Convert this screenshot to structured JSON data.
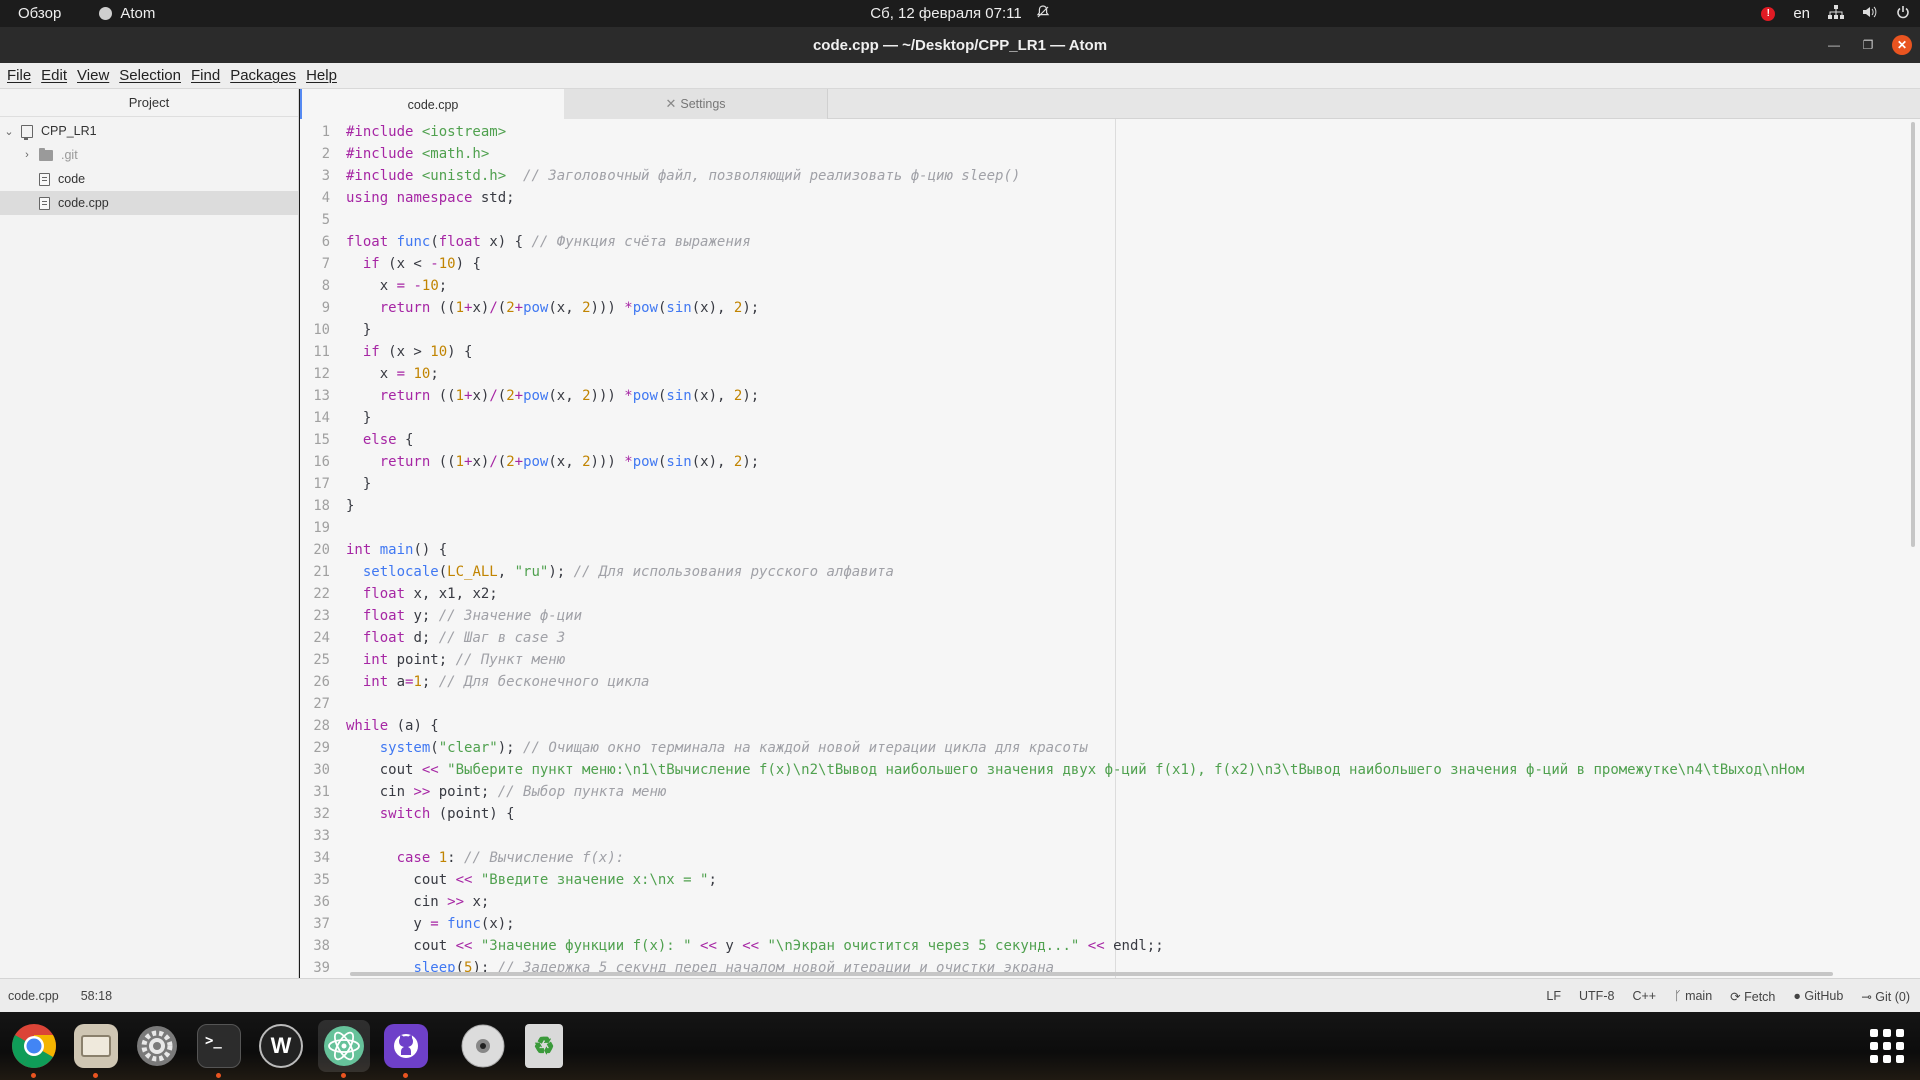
{
  "topbar": {
    "activities": "Обзор",
    "app_name": "Atom",
    "datetime": "Сб, 12 февраля  07:11",
    "notif_count": "!",
    "lang": "en"
  },
  "window": {
    "title": "code.cpp — ~/Desktop/CPP_LR1 — Atom"
  },
  "menu": [
    "File",
    "Edit",
    "View",
    "Selection",
    "Find",
    "Packages",
    "Help"
  ],
  "tree": {
    "header": "Project",
    "root": "CPP_LR1",
    "items": [
      ".git",
      "code",
      "code.cpp"
    ]
  },
  "tabs": [
    {
      "label": "code.cpp"
    },
    {
      "label": "Settings"
    }
  ],
  "editor": {
    "line_numbers": [
      "1",
      "2",
      "3",
      "4",
      "5",
      "6",
      "7",
      "8",
      "9",
      "10",
      "11",
      "12",
      "13",
      "14",
      "15",
      "16",
      "17",
      "18",
      "19",
      "20",
      "21",
      "22",
      "23",
      "24",
      "25",
      "26",
      "27",
      "28",
      "29",
      "30",
      "31",
      "32",
      "33",
      "34",
      "35",
      "36",
      "37",
      "38",
      "39"
    ],
    "lines": [
      [
        [
          "pp",
          "#include "
        ],
        [
          "str",
          "<iostream>"
        ]
      ],
      [
        [
          "pp",
          "#include "
        ],
        [
          "str",
          "<math.h>"
        ]
      ],
      [
        [
          "pp",
          "#include "
        ],
        [
          "str",
          "<unistd.h>"
        ],
        [
          "",
          "  "
        ],
        [
          "cm",
          "// Заголовочный файл, позволяющий реализовать ф-цию sleep()"
        ]
      ],
      [
        [
          "kw",
          "using"
        ],
        [
          "",
          " "
        ],
        [
          "kw",
          "namespace"
        ],
        [
          "",
          " std;"
        ]
      ],
      [],
      [
        [
          "ty",
          "float"
        ],
        [
          "",
          " "
        ],
        [
          "fn",
          "func"
        ],
        [
          "",
          "("
        ],
        [
          "ty",
          "float"
        ],
        [
          "",
          " x) { "
        ],
        [
          "cm",
          "// Функция счёта выражения"
        ]
      ],
      [
        [
          "",
          "  "
        ],
        [
          "kw",
          "if"
        ],
        [
          "",
          " (x < "
        ],
        [
          "op",
          "-"
        ],
        [
          "num",
          "10"
        ],
        [
          "",
          ") {"
        ]
      ],
      [
        [
          "",
          "    x "
        ],
        [
          "op",
          "="
        ],
        [
          "",
          " "
        ],
        [
          "op",
          "-"
        ],
        [
          "num",
          "10"
        ],
        [
          "",
          ";"
        ]
      ],
      [
        [
          "",
          "    "
        ],
        [
          "kw",
          "return"
        ],
        [
          "",
          " (("
        ],
        [
          "num",
          "1"
        ],
        [
          "op",
          "+"
        ],
        [
          "",
          "x)"
        ],
        [
          "op",
          "/"
        ],
        [
          "",
          "("
        ],
        [
          "num",
          "2"
        ],
        [
          "op",
          "+"
        ],
        [
          "fn",
          "pow"
        ],
        [
          "",
          "(x, "
        ],
        [
          "num",
          "2"
        ],
        [
          "",
          "))) "
        ],
        [
          "op",
          "*"
        ],
        [
          "fn",
          "pow"
        ],
        [
          "",
          "("
        ],
        [
          "fn",
          "sin"
        ],
        [
          "",
          "(x), "
        ],
        [
          "num",
          "2"
        ],
        [
          "",
          ");"
        ]
      ],
      [
        [
          "",
          "  }"
        ]
      ],
      [
        [
          "",
          "  "
        ],
        [
          "kw",
          "if"
        ],
        [
          "",
          " (x > "
        ],
        [
          "num",
          "10"
        ],
        [
          "",
          ") {"
        ]
      ],
      [
        [
          "",
          "    x "
        ],
        [
          "op",
          "="
        ],
        [
          "",
          " "
        ],
        [
          "num",
          "10"
        ],
        [
          "",
          ";"
        ]
      ],
      [
        [
          "",
          "    "
        ],
        [
          "kw",
          "return"
        ],
        [
          "",
          " (("
        ],
        [
          "num",
          "1"
        ],
        [
          "op",
          "+"
        ],
        [
          "",
          "x)"
        ],
        [
          "op",
          "/"
        ],
        [
          "",
          "("
        ],
        [
          "num",
          "2"
        ],
        [
          "op",
          "+"
        ],
        [
          "fn",
          "pow"
        ],
        [
          "",
          "(x, "
        ],
        [
          "num",
          "2"
        ],
        [
          "",
          "))) "
        ],
        [
          "op",
          "*"
        ],
        [
          "fn",
          "pow"
        ],
        [
          "",
          "("
        ],
        [
          "fn",
          "sin"
        ],
        [
          "",
          "(x), "
        ],
        [
          "num",
          "2"
        ],
        [
          "",
          ");"
        ]
      ],
      [
        [
          "",
          "  }"
        ]
      ],
      [
        [
          "",
          "  "
        ],
        [
          "kw",
          "else"
        ],
        [
          "",
          " {"
        ]
      ],
      [
        [
          "",
          "    "
        ],
        [
          "kw",
          "return"
        ],
        [
          "",
          " (("
        ],
        [
          "num",
          "1"
        ],
        [
          "op",
          "+"
        ],
        [
          "",
          "x)"
        ],
        [
          "op",
          "/"
        ],
        [
          "",
          "("
        ],
        [
          "num",
          "2"
        ],
        [
          "op",
          "+"
        ],
        [
          "fn",
          "pow"
        ],
        [
          "",
          "(x, "
        ],
        [
          "num",
          "2"
        ],
        [
          "",
          "))) "
        ],
        [
          "op",
          "*"
        ],
        [
          "fn",
          "pow"
        ],
        [
          "",
          "("
        ],
        [
          "fn",
          "sin"
        ],
        [
          "",
          "(x), "
        ],
        [
          "num",
          "2"
        ],
        [
          "",
          ");"
        ]
      ],
      [
        [
          "",
          "  }"
        ]
      ],
      [
        [
          "",
          "}"
        ]
      ],
      [],
      [
        [
          "ty",
          "int"
        ],
        [
          "",
          " "
        ],
        [
          "fn",
          "main"
        ],
        [
          "",
          "() {"
        ]
      ],
      [
        [
          "",
          "  "
        ],
        [
          "fn",
          "setlocale"
        ],
        [
          "",
          "("
        ],
        [
          "cn",
          "LC_ALL"
        ],
        [
          "",
          ", "
        ],
        [
          "str",
          "\"ru\""
        ],
        [
          "",
          "); "
        ],
        [
          "cm",
          "// Для использования русского алфавита"
        ]
      ],
      [
        [
          "",
          "  "
        ],
        [
          "ty",
          "float"
        ],
        [
          "",
          " x, x1, x2;"
        ]
      ],
      [
        [
          "",
          "  "
        ],
        [
          "ty",
          "float"
        ],
        [
          "",
          " y; "
        ],
        [
          "cm",
          "// Значение ф-ции"
        ]
      ],
      [
        [
          "",
          "  "
        ],
        [
          "ty",
          "float"
        ],
        [
          "",
          " d; "
        ],
        [
          "cm",
          "// Шаг в case 3"
        ]
      ],
      [
        [
          "",
          "  "
        ],
        [
          "ty",
          "int"
        ],
        [
          "",
          " point; "
        ],
        [
          "cm",
          "// Пункт меню"
        ]
      ],
      [
        [
          "",
          "  "
        ],
        [
          "ty",
          "int"
        ],
        [
          "",
          " a"
        ],
        [
          "op",
          "="
        ],
        [
          "num",
          "1"
        ],
        [
          "",
          "; "
        ],
        [
          "cm",
          "// Для бесконечного цикла"
        ]
      ],
      [],
      [
        [
          "kw",
          "while"
        ],
        [
          "",
          " (a) {"
        ]
      ],
      [
        [
          "",
          "    "
        ],
        [
          "fn",
          "system"
        ],
        [
          "",
          "("
        ],
        [
          "str",
          "\"clear\""
        ],
        [
          "",
          "); "
        ],
        [
          "cm",
          "// Очищаю окно терминала на каждой новой итерации цикла для красоты"
        ]
      ],
      [
        [
          "",
          "    cout "
        ],
        [
          "op",
          "<<"
        ],
        [
          "",
          " "
        ],
        [
          "str",
          "\"Выберите пункт меню:\\n1\\tВычисление f(x)\\n2\\tВывод наибольшего значения двух ф-ций f(x1), f(x2)\\n3\\tВывод наибольшего значения ф-ций в промежутке\\n4\\tВыход\\nНом"
        ]
      ],
      [
        [
          "",
          "    cin "
        ],
        [
          "op",
          ">>"
        ],
        [
          "",
          " point; "
        ],
        [
          "cm",
          "// Выбор пункта меню"
        ]
      ],
      [
        [
          "",
          "    "
        ],
        [
          "kw",
          "switch"
        ],
        [
          "",
          " (point) {"
        ]
      ],
      [],
      [
        [
          "",
          "      "
        ],
        [
          "kw",
          "case"
        ],
        [
          "",
          " "
        ],
        [
          "num",
          "1"
        ],
        [
          "",
          ": "
        ],
        [
          "cm",
          "// Вычисление f(x):"
        ]
      ],
      [
        [
          "",
          "        cout "
        ],
        [
          "op",
          "<<"
        ],
        [
          "",
          " "
        ],
        [
          "str",
          "\"Введите значение x:\\nx = \""
        ],
        [
          "",
          ";"
        ]
      ],
      [
        [
          "",
          "        cin "
        ],
        [
          "op",
          ">>"
        ],
        [
          "",
          " x;"
        ]
      ],
      [
        [
          "",
          "        y "
        ],
        [
          "op",
          "="
        ],
        [
          "",
          " "
        ],
        [
          "fn",
          "func"
        ],
        [
          "",
          "(x);"
        ]
      ],
      [
        [
          "",
          "        cout "
        ],
        [
          "op",
          "<<"
        ],
        [
          "",
          " "
        ],
        [
          "str",
          "\"Значение функции f(x): \""
        ],
        [
          "",
          " "
        ],
        [
          "op",
          "<<"
        ],
        [
          "",
          " y "
        ],
        [
          "op",
          "<<"
        ],
        [
          "",
          " "
        ],
        [
          "str",
          "\"\\nЭкран очистится через 5 секунд...\""
        ],
        [
          "",
          " "
        ],
        [
          "op",
          "<<"
        ],
        [
          "",
          " endl;;"
        ]
      ],
      [
        [
          "",
          "        "
        ],
        [
          "fn",
          "sleep"
        ],
        [
          "",
          "("
        ],
        [
          "num",
          "5"
        ],
        [
          "",
          "); "
        ],
        [
          "cm",
          "// Задержка 5 секунд перед началом новой итерации и очистки экрана"
        ]
      ]
    ]
  },
  "status": {
    "file": "code.cpp",
    "cursor": "58:18",
    "line_ending": "LF",
    "encoding": "UTF-8",
    "grammar": "C++",
    "branch": "main",
    "fetch": "Fetch",
    "github": "GitHub",
    "git": "Git (0)"
  },
  "dock": {
    "apps": [
      "chrome-icon",
      "files-icon",
      "settings-icon",
      "terminal-icon",
      "webstorm-icon",
      "atom-icon",
      "github-desktop-icon",
      "disc-icon",
      "trash-icon"
    ]
  }
}
